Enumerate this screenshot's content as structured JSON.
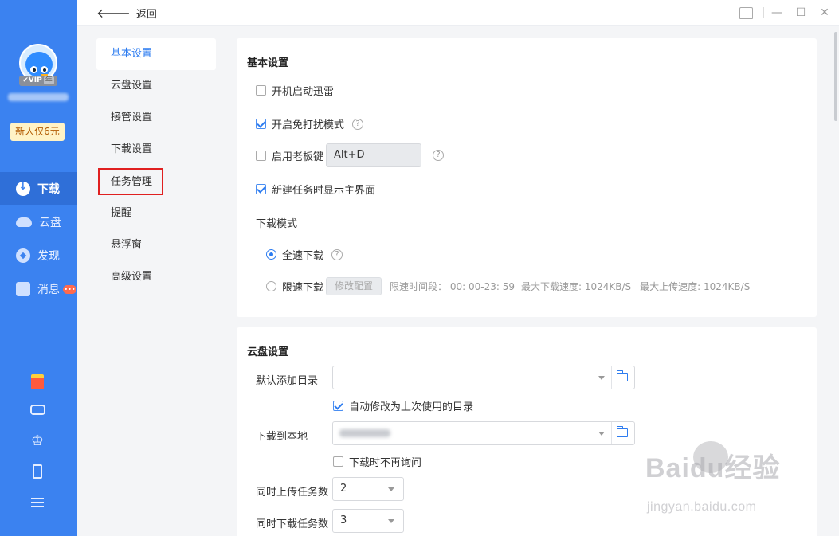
{
  "titlebar": {
    "back_label": "返回",
    "window_buttons": [
      "skin-icon",
      "minimize-icon",
      "maximize-icon",
      "close-icon"
    ]
  },
  "app_sidebar": {
    "vip_badge": "VIP",
    "vip_year": "年",
    "promo": "新人仅6元",
    "nav": [
      {
        "label": "下载",
        "icon": "download-icon",
        "active": true
      },
      {
        "label": "云盘",
        "icon": "cloud-icon",
        "active": false
      },
      {
        "label": "发现",
        "icon": "compass-icon",
        "active": false
      },
      {
        "label": "消息",
        "icon": "message-icon",
        "active": false,
        "badge": "•••"
      }
    ],
    "bottom_icons": [
      "red-packet-icon",
      "gamepad-icon",
      "crown-icon",
      "phone-icon",
      "menu-icon"
    ]
  },
  "settings_nav": {
    "items": [
      {
        "label": "基本设置",
        "active": true
      },
      {
        "label": "云盘设置"
      },
      {
        "label": "接管设置"
      },
      {
        "label": "下载设置"
      },
      {
        "label": "任务管理",
        "highlighted": true
      },
      {
        "label": "提醒"
      },
      {
        "label": "悬浮窗"
      },
      {
        "label": "高级设置"
      }
    ]
  },
  "basic": {
    "title": "基本设置",
    "autostart": {
      "label": "开机启动迅雷",
      "checked": false
    },
    "dnd": {
      "label": "开启免打扰模式",
      "checked": true
    },
    "boss_key": {
      "label": "启用老板键",
      "checked": false,
      "value": "Alt+D"
    },
    "show_main": {
      "label": "新建任务时显示主界面",
      "checked": true
    },
    "download_mode": {
      "label": "下载模式",
      "full_speed": {
        "label": "全速下载",
        "selected": true
      },
      "limited": {
        "label": "限速下载",
        "selected": false,
        "button": "修改配置",
        "period": "限速时间段： 00: 00-23: 59",
        "max_down": "最大下载速度: 1024KB/S",
        "max_up": "最大上传速度: 1024KB/S"
      }
    }
  },
  "cloud": {
    "title": "云盘设置",
    "default_dir": {
      "label": "默认添加目录",
      "value": ""
    },
    "auto_modify": {
      "label": "自动修改为上次使用的目录",
      "checked": true
    },
    "download_local": {
      "label": "下载到本地"
    },
    "no_ask": {
      "label": "下载时不再询问",
      "checked": false
    },
    "upload_tasks": {
      "label": "同时上传任务数",
      "value": "2"
    },
    "download_tasks": {
      "label": "同时下载任务数",
      "value": "3"
    }
  },
  "watermark": {
    "logo": "Baidu经验",
    "sub": "jingyan.baidu.com"
  },
  "colors": {
    "sidebar": "#3b82f0",
    "accent": "#2d7cf0",
    "highlight_border": "#e02020"
  }
}
